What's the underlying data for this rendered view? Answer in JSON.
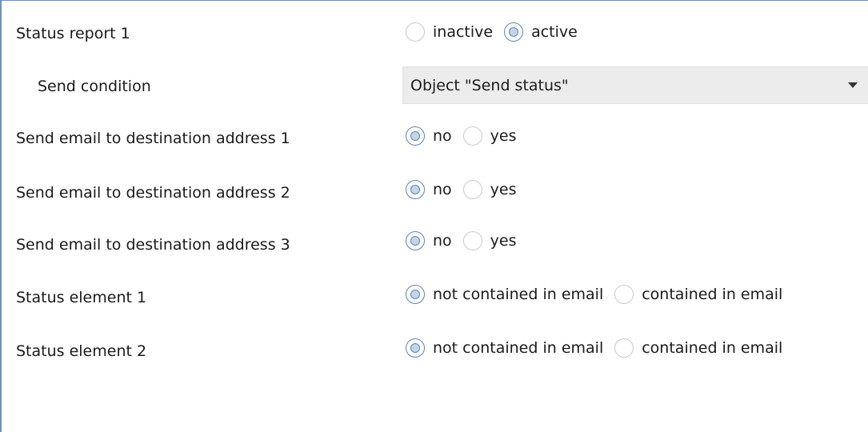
{
  "rows": {
    "status_report": {
      "label": "Status report 1",
      "options": [
        "inactive",
        "active"
      ],
      "selected": "active"
    },
    "send_condition": {
      "label": "Send condition",
      "value": "Object \"Send status\""
    },
    "dest1": {
      "label": "Send email to destination address 1",
      "options": [
        "no",
        "yes"
      ],
      "selected": "no"
    },
    "dest2": {
      "label": "Send email to destination address 2",
      "options": [
        "no",
        "yes"
      ],
      "selected": "no"
    },
    "dest3": {
      "label": "Send email to destination address 3",
      "options": [
        "no",
        "yes"
      ],
      "selected": "no"
    },
    "element1": {
      "label": "Status element 1",
      "options": [
        "not contained in email",
        "contained in email"
      ],
      "selected": "not contained in email"
    },
    "element2": {
      "label": "Status element 2",
      "options": [
        "not contained in email",
        "contained in email"
      ],
      "selected": "not contained in email"
    }
  },
  "colors": {
    "border_accent": "#6f8fb7",
    "radio_checked_fill": "#c3d5ea",
    "radio_checked_border": "#5d84b5",
    "dropdown_bg": "#ececec"
  }
}
